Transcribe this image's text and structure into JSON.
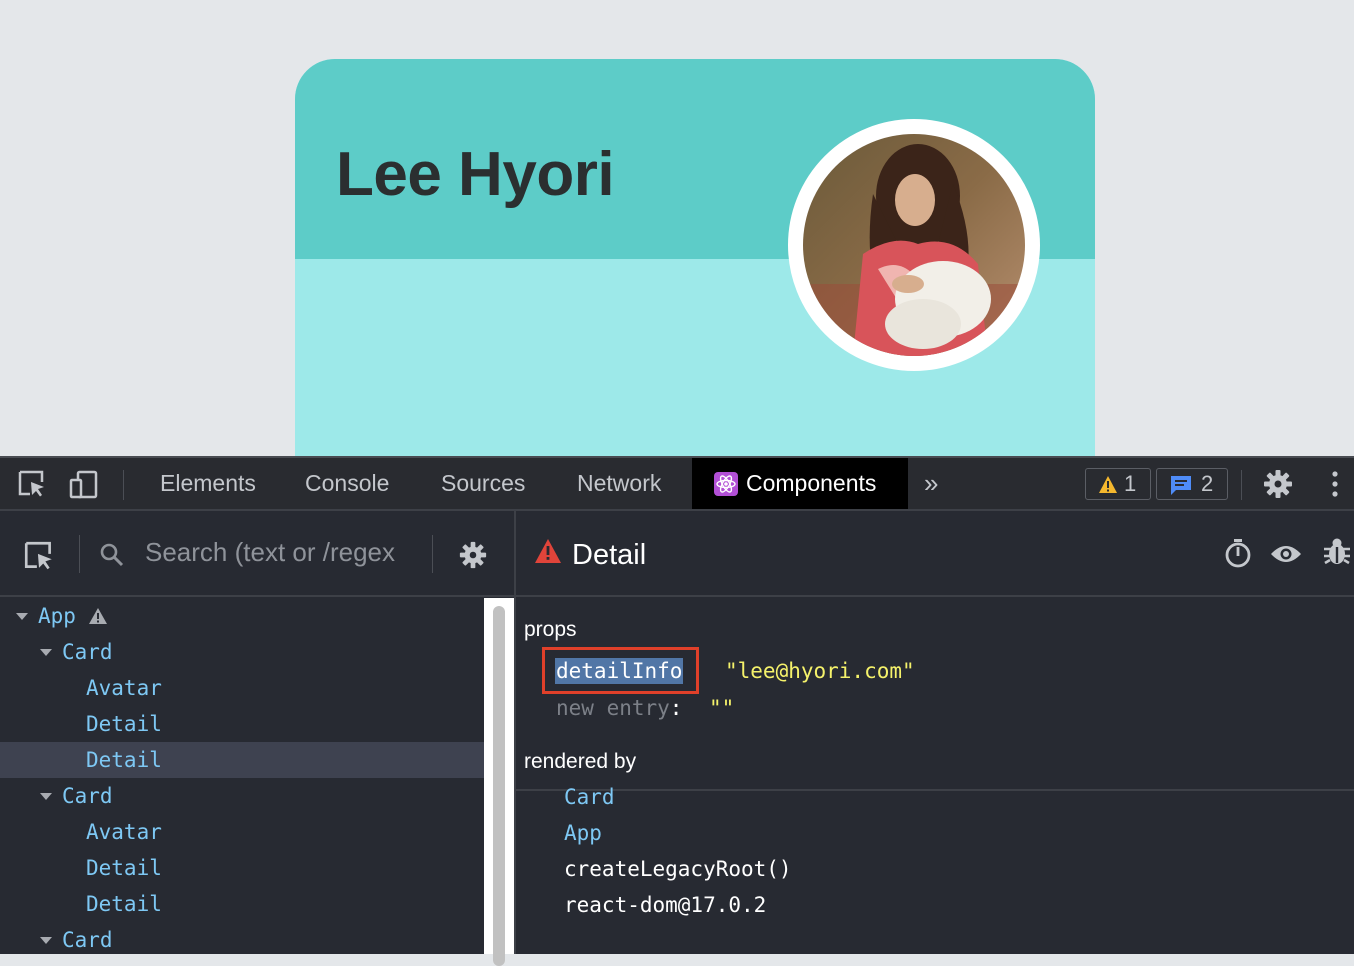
{
  "page": {
    "card_name": "Lee Hyori"
  },
  "devtools": {
    "tabs": [
      "Elements",
      "Console",
      "Sources",
      "Network",
      "Components"
    ],
    "active_tab": "Components",
    "warnings_count": "1",
    "messages_count": "2",
    "search_placeholder": "Search (text or /regex",
    "tree": [
      {
        "label": "App",
        "depth": 0,
        "expanded": true,
        "warning": true
      },
      {
        "label": "Card",
        "depth": 1,
        "expanded": true
      },
      {
        "label": "Avatar",
        "depth": 2
      },
      {
        "label": "Detail",
        "depth": 2
      },
      {
        "label": "Detail",
        "depth": 2,
        "selected": true
      },
      {
        "label": "Card",
        "depth": 1,
        "expanded": true
      },
      {
        "label": "Avatar",
        "depth": 2
      },
      {
        "label": "Detail",
        "depth": 2
      },
      {
        "label": "Detail",
        "depth": 2
      },
      {
        "label": "Card",
        "depth": 1,
        "expanded": true
      }
    ],
    "selected_component": "Detail",
    "props_heading": "props",
    "props": [
      {
        "key": "detailInfo",
        "value": "\"lee@hyori.com\""
      }
    ],
    "new_entry_label": "new entry",
    "new_entry_value": "\"\"",
    "rendered_by_heading": "rendered by",
    "rendered_by": [
      {
        "label": "Card",
        "component": true
      },
      {
        "label": "App",
        "component": true
      },
      {
        "label": "createLegacyRoot()",
        "component": false
      },
      {
        "label": "react-dom@17.0.2",
        "component": false
      }
    ],
    "colors": {
      "card_header": "#5dccc8",
      "card_body": "#9de9e9",
      "component_name": "#7ec8f4",
      "string_value": "#f5f26b",
      "highlight_border": "#e0402a"
    }
  }
}
